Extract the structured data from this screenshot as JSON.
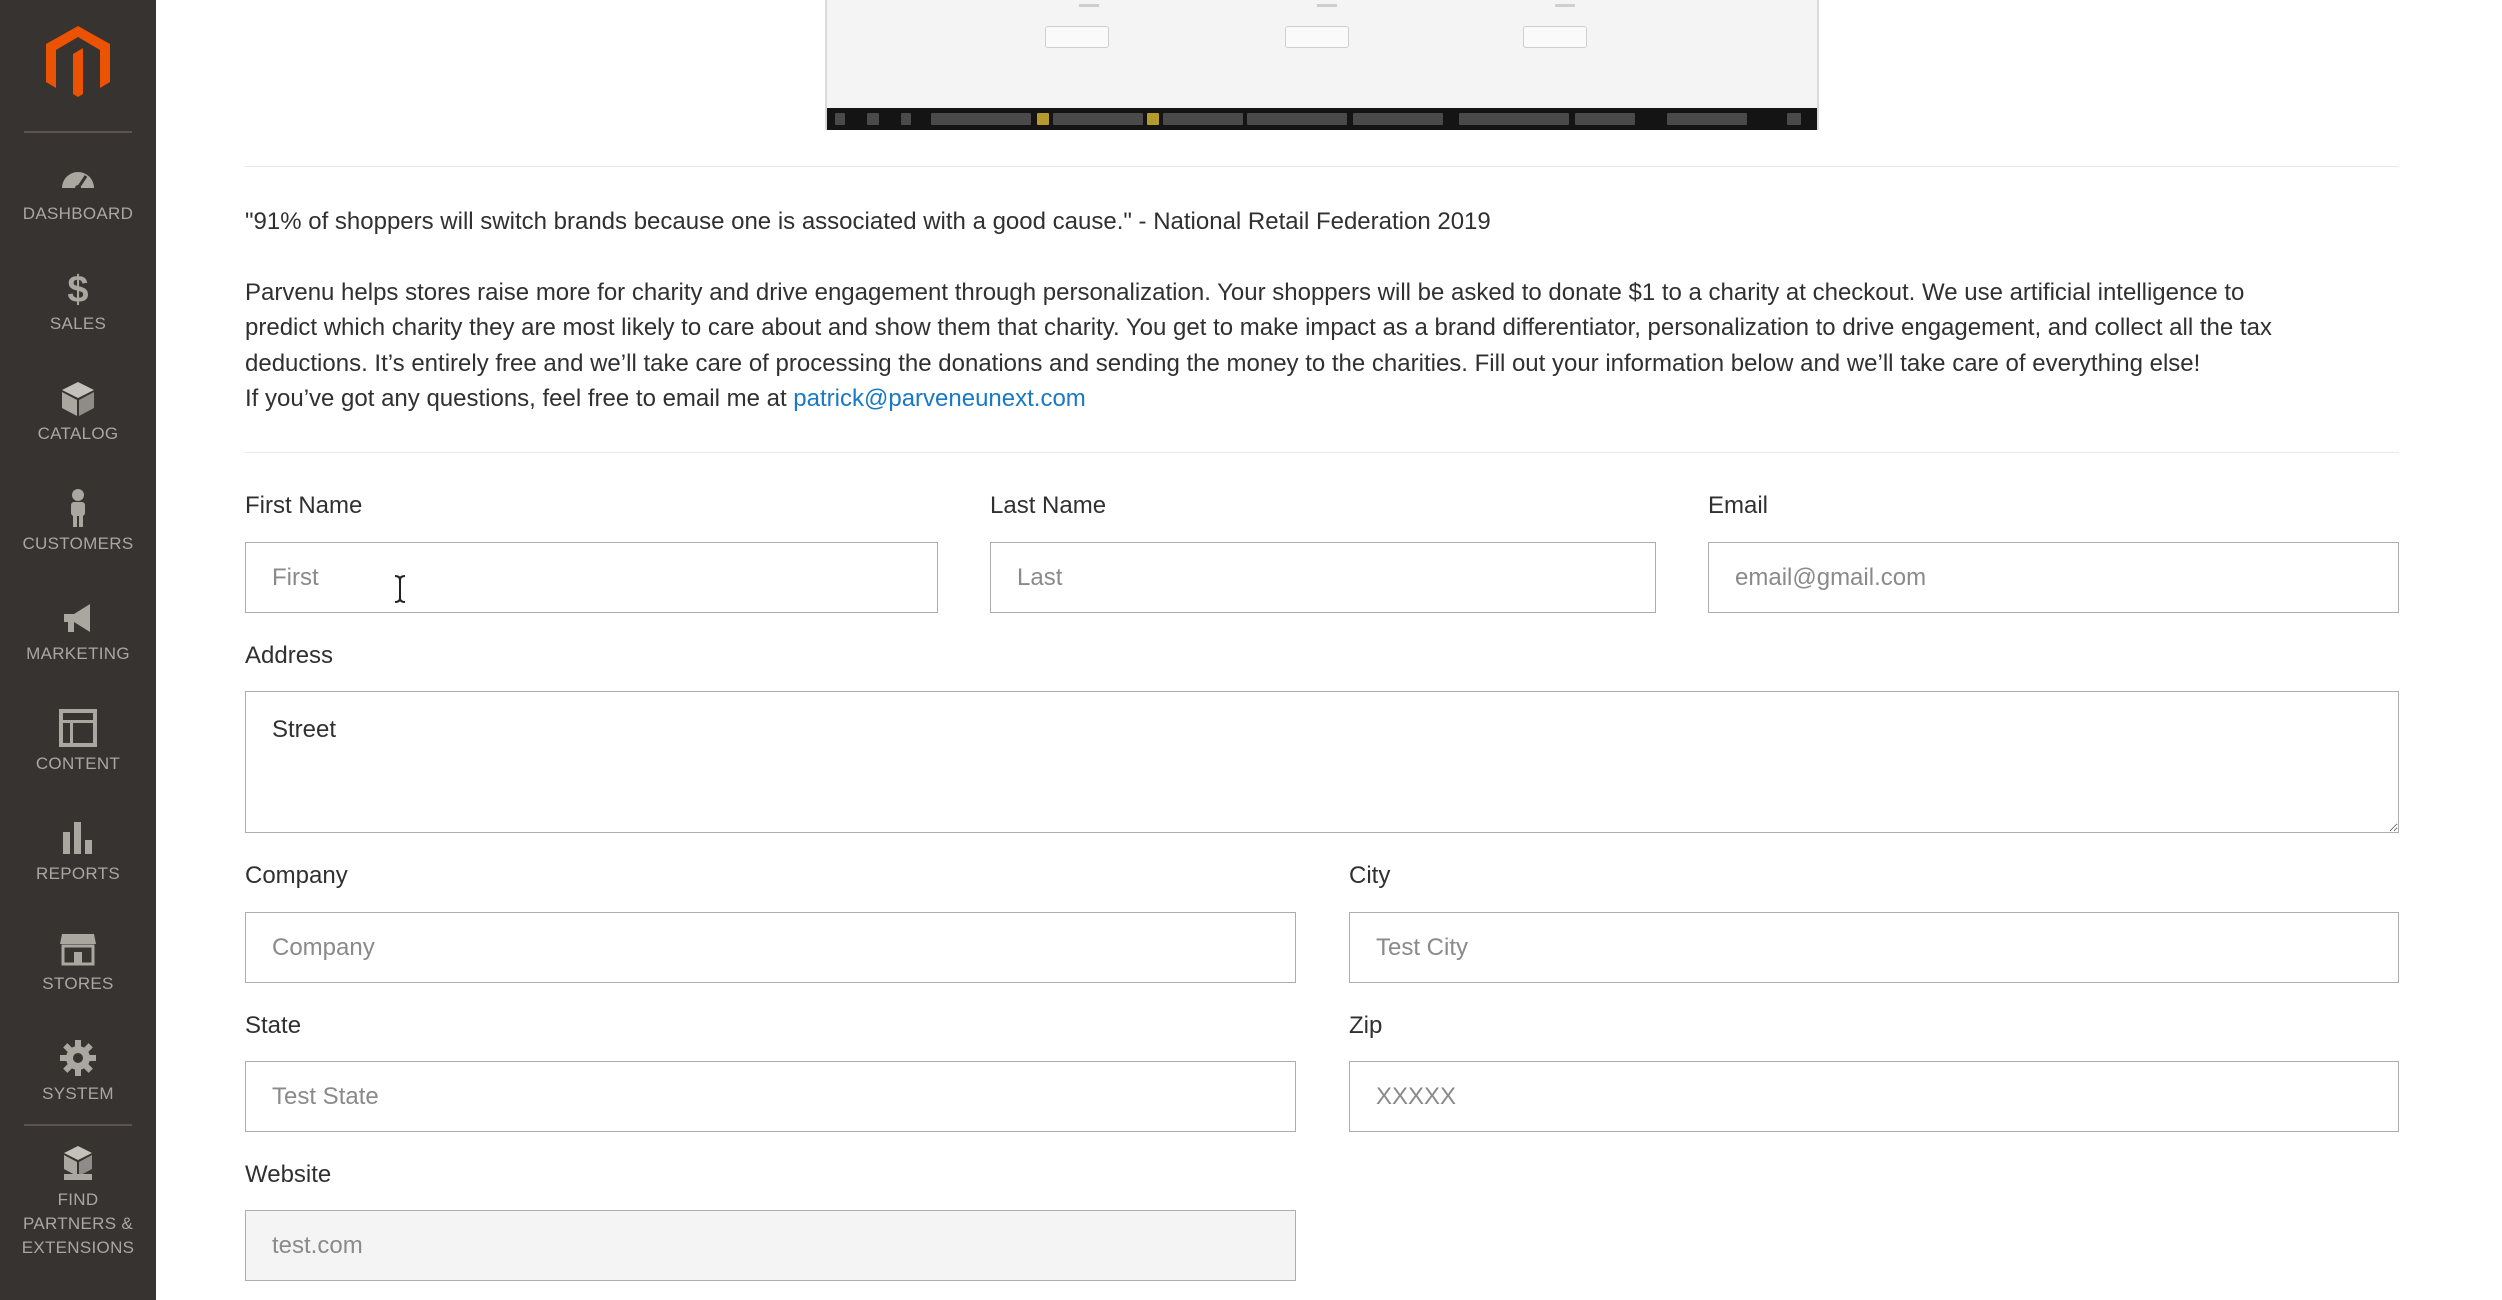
{
  "sidebar": {
    "logo": "magento-logo",
    "items": [
      {
        "label": "DASHBOARD",
        "icon": "dashboard-gauge-icon"
      },
      {
        "label": "SALES",
        "icon": "dollar-icon"
      },
      {
        "label": "CATALOG",
        "icon": "box-icon"
      },
      {
        "label": "CUSTOMERS",
        "icon": "person-icon"
      },
      {
        "label": "MARKETING",
        "icon": "megaphone-icon"
      },
      {
        "label": "CONTENT",
        "icon": "layout-icon"
      },
      {
        "label": "REPORTS",
        "icon": "bar-chart-icon"
      },
      {
        "label": "STORES",
        "icon": "storefront-icon"
      },
      {
        "label": "SYSTEM",
        "icon": "gear-icon"
      }
    ],
    "extensions": {
      "line1": "FIND",
      "line2": "PARTNERS &",
      "line3": "EXTENSIONS",
      "icon": "cubes-icon"
    }
  },
  "content": {
    "quote": "\"91% of shoppers will switch brands because one is associated with a good cause.\" - National Retail Federation 2019",
    "paragraph": {
      "line1": "Parvenu helps stores raise more for charity and drive engagement through personalization. Your shoppers will be asked to donate $1 to a charity at checkout. We use artificial intelligence to",
      "line2": "predict which charity they are most likely to care about and show them that charity. You get to make impact as a brand differentiator, personalization to drive engagement, and collect all the tax",
      "line3": "deductions. It’s entirely free and we’ll take care of processing the donations and sending the money to the charities. Fill out your information below and we’ll take care of everything else!",
      "line4_prefix": "If you’ve got any questions, feel free to email me at ",
      "email_link": "patrick@parveneunext.com"
    }
  },
  "form": {
    "first_name": {
      "label": "First Name",
      "placeholder": "First"
    },
    "last_name": {
      "label": "Last Name",
      "placeholder": "Last"
    },
    "email": {
      "label": "Email",
      "placeholder": "email@gmail.com"
    },
    "address": {
      "label": "Address",
      "value": "Street"
    },
    "company": {
      "label": "Company",
      "placeholder": "Company"
    },
    "city": {
      "label": "City",
      "placeholder": "Test City"
    },
    "state": {
      "label": "State",
      "placeholder": "Test State"
    },
    "zip": {
      "label": "Zip",
      "placeholder": "XXXXX"
    },
    "website": {
      "label": "Website",
      "placeholder": "test.com"
    }
  },
  "colors": {
    "sidebar_bg": "#373330",
    "sidebar_text": "#aaa6a0",
    "logo_orange": "#eb5202",
    "link": "#1979c3",
    "input_border": "#adadad"
  }
}
